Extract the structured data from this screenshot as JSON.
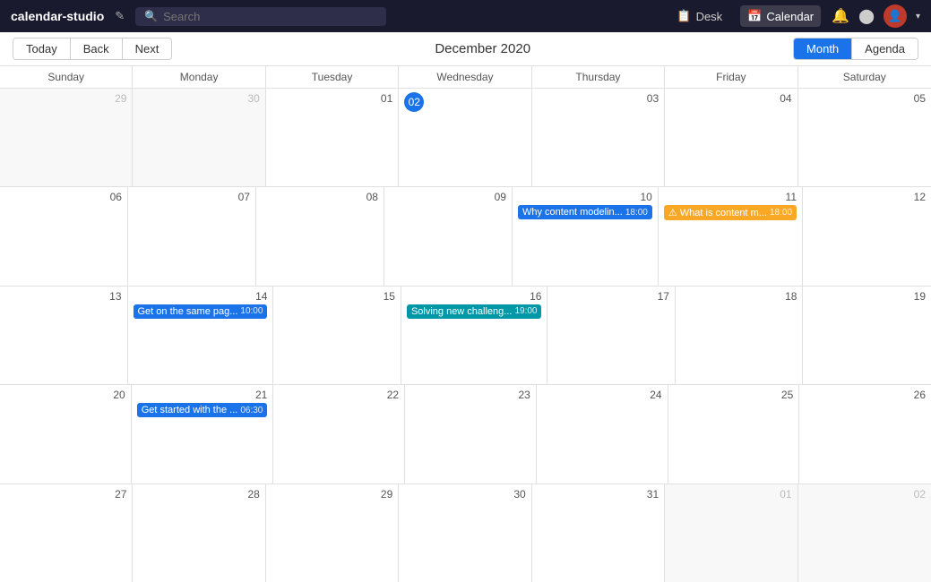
{
  "app": {
    "logo": "calendar-studio",
    "edit_icon": "✎",
    "search_placeholder": "Search"
  },
  "nav": {
    "desk_label": "Desk",
    "calendar_label": "Calendar",
    "desk_icon": "📋",
    "calendar_icon": "📅"
  },
  "toolbar": {
    "today_label": "Today",
    "back_label": "Back",
    "next_label": "Next",
    "month_title": "December 2020",
    "month_view_label": "Month",
    "agenda_view_label": "Agenda"
  },
  "day_headers": [
    "Sunday",
    "Monday",
    "Tuesday",
    "Wednesday",
    "Thursday",
    "Friday",
    "Saturday"
  ],
  "weeks": [
    [
      {
        "num": "29",
        "other": true
      },
      {
        "num": "30",
        "other": true
      },
      {
        "num": "01"
      },
      {
        "num": "02",
        "today": true
      },
      {
        "num": "03"
      },
      {
        "num": "04"
      },
      {
        "num": "05"
      }
    ],
    [
      {
        "num": "06"
      },
      {
        "num": "07"
      },
      {
        "num": "08"
      },
      {
        "num": "09"
      },
      {
        "num": "10",
        "events": [
          {
            "label": "Why content modelin...",
            "time": "18:00",
            "type": "blue"
          }
        ]
      },
      {
        "num": "11",
        "events": [
          {
            "label": "⚠ What is content m...",
            "time": "18:00",
            "type": "warning"
          }
        ]
      },
      {
        "num": "12"
      }
    ],
    [
      {
        "num": "13"
      },
      {
        "num": "14",
        "events": [
          {
            "label": "Get on the same pag...",
            "time": "10:00",
            "type": "blue"
          }
        ]
      },
      {
        "num": "15"
      },
      {
        "num": "16",
        "events": [
          {
            "label": "Solving new challeng...",
            "time": "19:00",
            "type": "teal"
          }
        ]
      },
      {
        "num": "17"
      },
      {
        "num": "18"
      },
      {
        "num": "19"
      }
    ],
    [
      {
        "num": "20"
      },
      {
        "num": "21",
        "events": [
          {
            "label": "Get started with the ...",
            "time": "06:30",
            "type": "blue"
          }
        ]
      },
      {
        "num": "22"
      },
      {
        "num": "23"
      },
      {
        "num": "24"
      },
      {
        "num": "25"
      },
      {
        "num": "26"
      }
    ],
    [
      {
        "num": "27"
      },
      {
        "num": "28"
      },
      {
        "num": "29"
      },
      {
        "num": "30"
      },
      {
        "num": "31"
      },
      {
        "num": "01",
        "other": true
      },
      {
        "num": "02",
        "other": true
      }
    ]
  ]
}
